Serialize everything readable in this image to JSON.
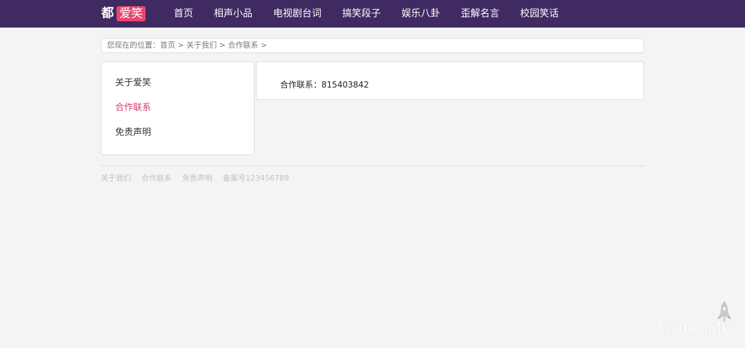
{
  "header": {
    "logo_text": "都",
    "logo_badge": "爱笑",
    "nav": [
      "首页",
      "相声小品",
      "电视剧台词",
      "搞笑段子",
      "娱乐八卦",
      "歪解名言",
      "校园笑话"
    ]
  },
  "breadcrumb": {
    "prefix": "您现在的位置：",
    "items": [
      "首页",
      "关于我们",
      "合作联系"
    ],
    "separator": ">"
  },
  "sidebar": {
    "items": [
      {
        "label": "关于爱笑",
        "active": false
      },
      {
        "label": "合作联系",
        "active": true
      },
      {
        "label": "免责声明",
        "active": false
      }
    ]
  },
  "content": {
    "text": "合作联系：815403842"
  },
  "footer": {
    "links": [
      "关于我们",
      "合作联系",
      "免责声明",
      "备案号123456789"
    ]
  },
  "brand": {
    "label": "ThinkCMF",
    "icon": "rocket-icon"
  },
  "colors": {
    "header_bg": "#3f2a62",
    "accent": "#e8466f",
    "active_link": "#e0386f",
    "page_bg": "#f4f4f4"
  }
}
